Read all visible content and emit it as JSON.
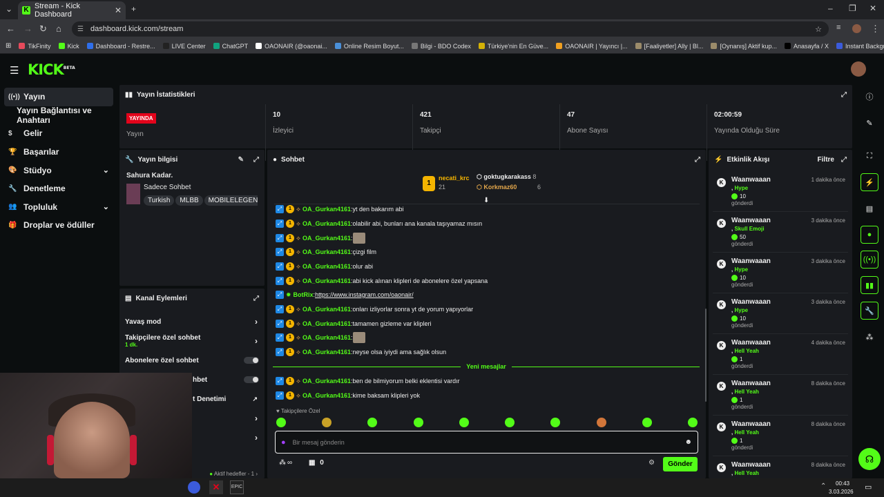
{
  "browser": {
    "tab_title": "Stream - Kick Dashboard",
    "url": "dashboard.kick.com/stream",
    "bookmarks": [
      "TikFinity",
      "Kick",
      "Dashboard - Restre...",
      "LIVE Center",
      "ChatGPT",
      "OAONAIR (@oaonai...",
      "Online Resim Boyut...",
      "Bilgi - BDO Codex",
      "Türkiye'nin En Güve...",
      "OAONAIR | Yayıncı |...",
      "[Faaliyetler] Ally | Bl...",
      "[Oynanış] Aktif kup...",
      "Anasayfa / X",
      "Instant Background..."
    ],
    "bookmark_colors": [
      "#e64a5b",
      "#53fc18",
      "#2f6feb",
      "#222222",
      "#10a37f",
      "#ffffff",
      "#4a90d9",
      "#777777",
      "#d4b106",
      "#f0a020",
      "#9b8b6a",
      "#9b8b6a",
      "#000000",
      "#3b5bdb"
    ]
  },
  "header": {
    "logo": "KICK",
    "logo_beta": "BETA"
  },
  "sidebar": {
    "items": [
      {
        "label": "Yayın",
        "icon": "broadcast-icon",
        "active": true
      },
      {
        "label": "Yayın Bağlantısı ve Anahtarı",
        "icon": "",
        "active": false
      },
      {
        "label": "Gelir",
        "icon": "dollar-icon",
        "active": false
      },
      {
        "label": "Başarılar",
        "icon": "trophy-icon",
        "active": false
      },
      {
        "label": "Stüdyo",
        "icon": "palette-icon",
        "active": false,
        "chevron": true
      },
      {
        "label": "Denetleme",
        "icon": "wrench-icon",
        "active": false
      },
      {
        "label": "Topluluk",
        "icon": "users-icon",
        "active": false,
        "chevron": true
      },
      {
        "label": "Droplar ve ödüller",
        "icon": "gift-icon",
        "active": false
      }
    ]
  },
  "stats": {
    "title": "Yayın İstatistikleri",
    "live_badge": "YAYINDA",
    "status_label": "Yayın",
    "viewers": "10",
    "viewers_label": "İzleyici",
    "followers": "421",
    "followers_label": "Takipçi",
    "subs": "47",
    "subs_label": "Abone Sayısı",
    "uptime": "02:00:59",
    "uptime_label": "Yayında Olduğu Süre"
  },
  "stream_info": {
    "title": "Yayın bilgisi",
    "stream_title": "Sahura Kadar.",
    "category": "Sadece Sohbet",
    "tags": [
      "Turkish",
      "MLBB",
      "MOBILELEGEN"
    ]
  },
  "channel_actions": {
    "title": "Kanal Eylemleri",
    "slow_mode": "Yavaş mod",
    "followers_only": "Takipçilere özel sohbet",
    "followers_only_sub": "1 dk.",
    "subs_only": "Abonelere özel sohbet",
    "emote_only_partial": "hbet",
    "moderation_partial": "t Denetimi",
    "goals": "Aktif hedefler - 1"
  },
  "chat": {
    "title": "Sohbet",
    "leader1": "necati_krc",
    "leader1_count": "21",
    "leader2": "goktugkarakass",
    "leader2_count": "8",
    "leader3": "Korkmaz60",
    "leader3_count": "6",
    "messages": [
      {
        "user": "OA_Gurkan4161",
        "text": "yt den bakarım abi"
      },
      {
        "user": "OA_Gurkan4161",
        "text": "olabilir abi, bunları ana kanala taşıyamaz mısın"
      },
      {
        "user": "OA_Gurkan4161",
        "text": "",
        "emote": true
      },
      {
        "user": "OA_Gurkan4161",
        "text": "çizgi film"
      },
      {
        "user": "OA_Gurkan4161",
        "text": "olur abi"
      },
      {
        "user": "OA_Gurkan4161",
        "text": "abi kick alınan klipleri de abonelere özel yapsana"
      },
      {
        "user": "BotRix",
        "text": "",
        "link": "https://www.instagram.com/oaonair/",
        "bot": true
      },
      {
        "user": "OA_Gurkan4161",
        "text": "onları izliyorlar sonra yt de yorum yapıyorlar"
      },
      {
        "user": "OA_Gurkan4161",
        "text": "tamamen gizleme var klipleri"
      },
      {
        "user": "OA_Gurkan4161",
        "text": "",
        "emote": true
      },
      {
        "user": "OA_Gurkan4161",
        "text": "neyse olsa iyiydi ama sağlık olsun"
      },
      {
        "user": "OA_Gurkan4161",
        "text": "ben de bilmiyorum belki eklentisi vardır"
      },
      {
        "user": "OA_Gurkan4161",
        "text": "kime baksam klipleri yok"
      }
    ],
    "new_messages": "Yeni mesajlar",
    "follower_only_label": "Takipçilere Özel",
    "input_placeholder": "Bir mesaj gönderin",
    "send": "Gönder",
    "points": "∞",
    "gift_count": "0"
  },
  "events": {
    "title": "Etkinlik Akışı",
    "filter": "Filtre",
    "items": [
      {
        "user": "Waanwaaan",
        "time": "1 dakika önce",
        "gift": "Hype",
        "amount": "10",
        "sent": "gönderdi"
      },
      {
        "user": "Waanwaaan",
        "time": "3 dakika önce",
        "gift": "Skull Emoji",
        "amount": "50",
        "sent": "gönderdi"
      },
      {
        "user": "Waanwaaan",
        "time": "3 dakika önce",
        "gift": "Hype",
        "amount": "10",
        "sent": "gönderdi"
      },
      {
        "user": "Waanwaaan",
        "time": "3 dakika önce",
        "gift": "Hype",
        "amount": "10",
        "sent": "gönderdi"
      },
      {
        "user": "Waanwaaan",
        "time": "4 dakika önce",
        "gift": "Hell Yeah",
        "amount": "1",
        "sent": "gönderdi"
      },
      {
        "user": "Waanwaaan",
        "time": "8 dakika önce",
        "gift": "Hell Yeah",
        "amount": "1",
        "sent": "gönderdi"
      },
      {
        "user": "Waanwaaan",
        "time": "8 dakika önce",
        "gift": "Hell Yeah",
        "amount": "1",
        "sent": "gönderdi"
      },
      {
        "user": "Waanwaaan",
        "time": "8 dakika önce",
        "gift": "Hell Yeah",
        "amount": "",
        "sent": ""
      }
    ]
  },
  "taskbar": {
    "time": "00:43",
    "date": "3.03.2026"
  },
  "colors": {
    "accent": "#53fc18",
    "live": "#e3041b"
  }
}
